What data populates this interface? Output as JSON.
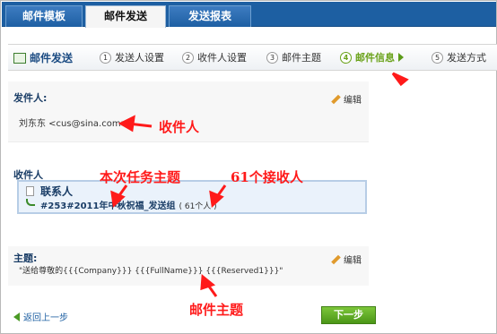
{
  "tabs": {
    "items": [
      {
        "label": "邮件模板"
      },
      {
        "label": "邮件发送"
      },
      {
        "label": "发送报表"
      }
    ]
  },
  "steps": {
    "home_label": "邮件发送",
    "items": [
      {
        "num": "1",
        "label": "发送人设置"
      },
      {
        "num": "2",
        "label": "收件人设置"
      },
      {
        "num": "3",
        "label": "邮件主题"
      },
      {
        "num": "4",
        "label": "邮件信息"
      },
      {
        "num": "5",
        "label": "发送方式"
      }
    ]
  },
  "sender": {
    "label": "发件人:",
    "edit_label": "编辑",
    "value": "刘东东 <cus@sina.com>"
  },
  "recipients": {
    "label": "收件人",
    "title": "联系人",
    "group": "#253#2011年中秋祝福_发送组",
    "count": "( 61个人 )"
  },
  "subject": {
    "label": "主题:",
    "edit_label": "编辑",
    "value": "\"送给尊敬的{{{Company}}} {{{FullName}}} {{{Reserved1}}}\""
  },
  "footer": {
    "back_label": "返回上一步",
    "next_label": "下一步"
  },
  "annotations": {
    "recipient": "收件人",
    "task_subject": "本次任务主题",
    "count": "61个接收人",
    "mail_subject": "邮件主题"
  },
  "colors": {
    "tab_bar": "#1d5fa2",
    "active_step": "#6aa21a",
    "annotation": "#ff1a1a"
  }
}
